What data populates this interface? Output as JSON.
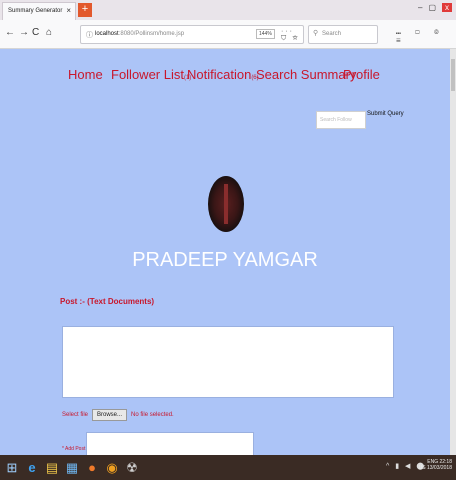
{
  "browser": {
    "tab_title": "Summary Generator",
    "tab_close": "×",
    "new_tab": "+",
    "window_min": "–",
    "window_max": "▢",
    "window_close": "x",
    "nav": {
      "back": "←",
      "forward": "→",
      "reload": "C",
      "home": "⌂"
    },
    "url_host": "localhost",
    "url_rest": ":8080/Pollinsm/home.jsp",
    "zoom": "144%",
    "page_actions": "··· ⛉ ☆",
    "search_placeholder": "Search",
    "tools": "⑉ ▢ ◎ ≡"
  },
  "menu": {
    "home": "Home",
    "follower_list": "Follower List",
    "follower_count": "(1)",
    "notification": "Notification",
    "notification_count": "(6)",
    "search_summary": "Search Summary",
    "profile": "Profile"
  },
  "query": {
    "placeholder": "Search Follow",
    "submit_label": "Submit Query"
  },
  "profile": {
    "name": "PRADEEP YAMGAR"
  },
  "post": {
    "heading": "Post :- (Text Documents)",
    "select_label": "Select file",
    "browse_label": "Browse...",
    "no_file": "No file selected.",
    "add_label": "* Add Post"
  },
  "taskbar": {
    "start": "⊞",
    "apps": [
      "e",
      "▤",
      "▦",
      "●",
      "◉",
      "☢"
    ],
    "tray_icons": "^ ▮ ◀ ⬤",
    "lang": "ENG",
    "region": "US",
    "time": "22:18",
    "date": "13/03/2018"
  }
}
